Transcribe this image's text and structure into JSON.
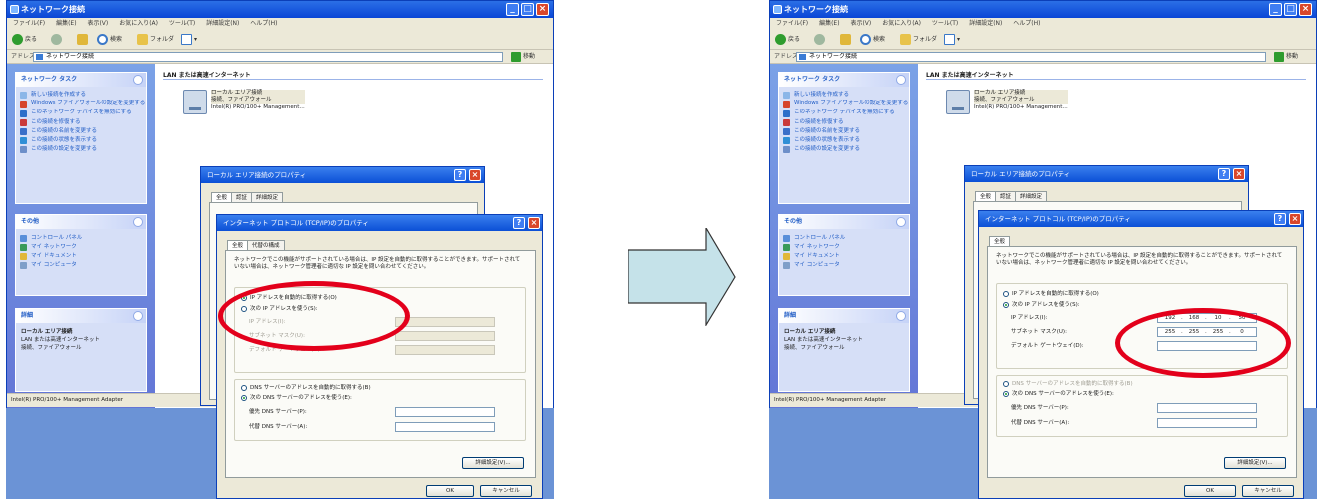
{
  "explorer": {
    "title": "ネットワーク接続",
    "menu": [
      "ファイル(F)",
      "編集(E)",
      "表示(V)",
      "お気に入り(A)",
      "ツール(T)",
      "詳細設定(N)",
      "ヘルプ(H)"
    ],
    "toolbar": {
      "back": "戻る",
      "search": "検索",
      "folders": "フォルダ"
    },
    "address_label": "アドレス(D)",
    "address_value": "ネットワーク接続",
    "go_label": "移動",
    "tasks": {
      "title": "ネットワーク タスク",
      "items": [
        "新しい接続を作成する",
        "Windows ファイアウォールの設定を変更する",
        "このネットワーク デバイスを無効にする",
        "この接続を修復する",
        "この接続の名前を変更する",
        "この接続の状態を表示する",
        "この接続の設定を変更する"
      ]
    },
    "other_places": {
      "title": "その他",
      "items": [
        "コントロール パネル",
        "マイ ネットワーク",
        "マイ ドキュメント",
        "マイ コンピュータ"
      ]
    },
    "details": {
      "title": "詳細",
      "name": "ローカル エリア接続",
      "lines": [
        "LAN または高速インターネット",
        "接続、ファイアウォール"
      ]
    },
    "category_header": "LAN または高速インターネット",
    "connection": {
      "name": "ローカル エリア接続",
      "status": "接続、ファイアウォール",
      "adapter": "Intel(R) PRO/100+ Management..."
    },
    "status_bar": "Intel(R) PRO/100+ Management Adapter"
  },
  "lan_props": {
    "title": "ローカル エリア接続のプロパティ",
    "tabs": [
      "全般",
      "認証",
      "詳細設定"
    ]
  },
  "tcpip": {
    "title": "インターネット プロトコル (TCP/IP)のプロパティ",
    "tabs_before": [
      "全般",
      "代替の構成"
    ],
    "tabs_after": [
      "全般"
    ],
    "description": "ネットワークでこの機能がサポートされている場合は、IP 設定を自動的に取得することができます。サポートされていない場合は、ネットワーク管理者に適切な IP 設定を問い合わせてください。",
    "radio_auto_ip": "IP アドレスを自動的に取得する(O)",
    "radio_manual_ip": "次の IP アドレスを使う(S):",
    "label_ip": "IP アドレス(I):",
    "label_subnet": "サブネット マスク(U):",
    "label_gateway": "デフォルト ゲートウェイ(D):",
    "radio_auto_dns": "DNS サーバーのアドレスを自動的に取得する(B)",
    "radio_manual_dns": "次の DNS サーバーのアドレスを使う(E):",
    "label_dns1": "優先 DNS サーバー(P):",
    "label_dns2": "代替 DNS サーバー(A):",
    "advanced_button": "詳細設定(V)...",
    "ok_button": "OK",
    "cancel_button": "キャンセル",
    "ip_after": [
      "192",
      "168",
      "10",
      "50"
    ],
    "subnet_after": [
      "255",
      "255",
      "255",
      "0"
    ]
  },
  "highlight_color": "#e3001b",
  "arrow_fill": "#c5e2e9"
}
